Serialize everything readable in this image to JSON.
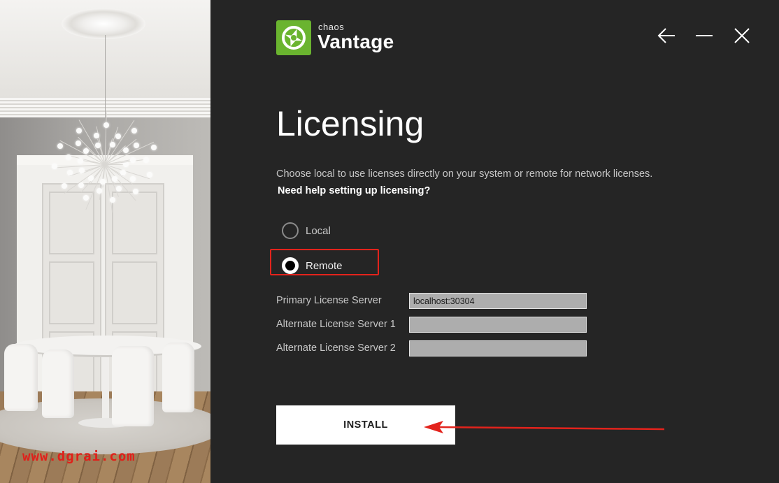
{
  "brand": {
    "company": "chaos",
    "product": "Vantage",
    "accent_color": "#6ab42f"
  },
  "window_controls": {
    "back_icon": "arrow-left-icon",
    "minimize_icon": "minimize-icon",
    "close_icon": "close-icon"
  },
  "page": {
    "title": "Licensing",
    "description": "Choose local to use licenses directly on your system or remote for network licenses.",
    "help_link": "Need help setting up licensing?"
  },
  "license_mode": {
    "options": [
      {
        "label": "Local",
        "selected": false
      },
      {
        "label": "Remote",
        "selected": true
      }
    ]
  },
  "servers": {
    "primary_label": "Primary License Server",
    "primary_value": "localhost:30304",
    "alt1_label": "Alternate License Server 1",
    "alt1_value": "",
    "alt2_label": "Alternate License Server 2",
    "alt2_value": ""
  },
  "actions": {
    "install_label": "INSTALL"
  },
  "annotations": {
    "watermark": "www.dgrai.com",
    "highlight_color": "#e3231c"
  }
}
